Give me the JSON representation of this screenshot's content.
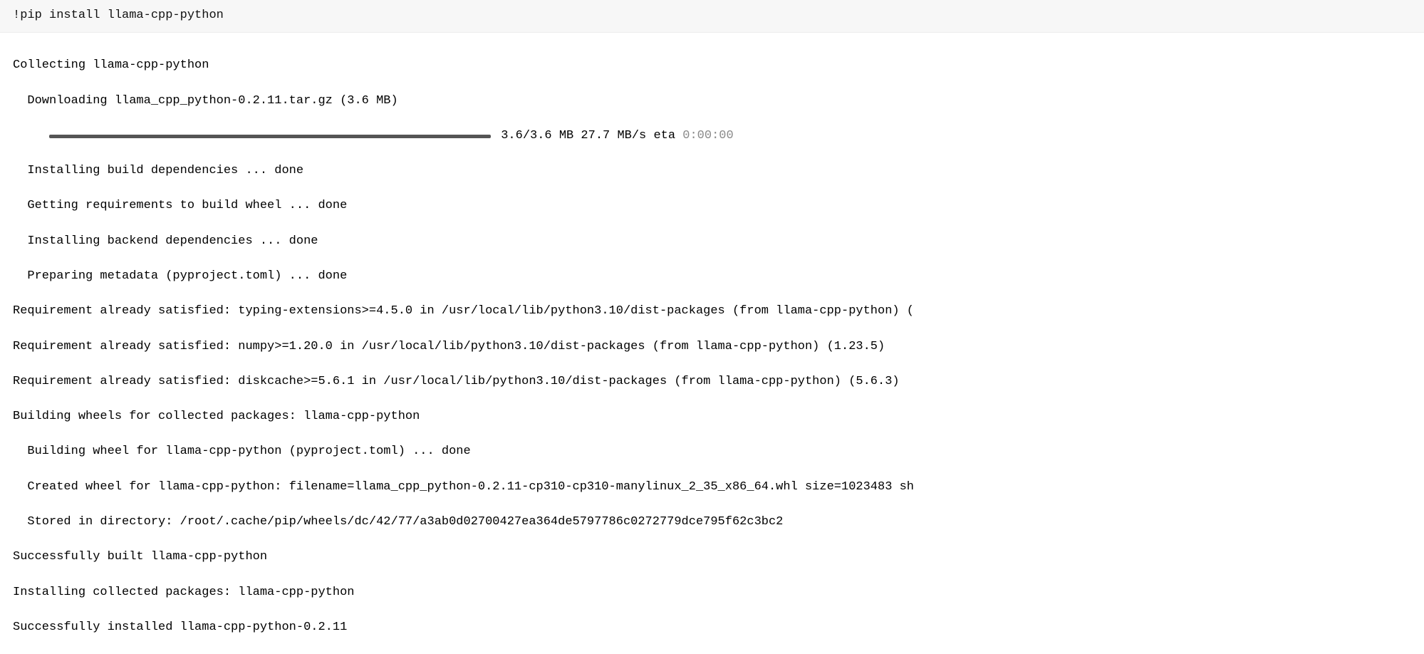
{
  "code_cell": {
    "command": "!pip install llama-cpp-python"
  },
  "output": {
    "line1": "Collecting llama-cpp-python",
    "line2": "  Downloading llama_cpp_python-0.2.11.tar.gz (3.6 MB)",
    "progress_indent": "     ",
    "progress_stats": " 3.6/3.6 MB 27.7 MB/s eta ",
    "progress_eta": "0:00:00",
    "line4": "  Installing build dependencies ... done",
    "line5": "  Getting requirements to build wheel ... done",
    "line6": "  Installing backend dependencies ... done",
    "line7": "  Preparing metadata (pyproject.toml) ... done",
    "line8": "Requirement already satisfied: typing-extensions>=4.5.0 in /usr/local/lib/python3.10/dist-packages (from llama-cpp-python) (",
    "line9": "Requirement already satisfied: numpy>=1.20.0 in /usr/local/lib/python3.10/dist-packages (from llama-cpp-python) (1.23.5)",
    "line10": "Requirement already satisfied: diskcache>=5.6.1 in /usr/local/lib/python3.10/dist-packages (from llama-cpp-python) (5.6.3)",
    "line11": "Building wheels for collected packages: llama-cpp-python",
    "line12": "  Building wheel for llama-cpp-python (pyproject.toml) ... done",
    "line13": "  Created wheel for llama-cpp-python: filename=llama_cpp_python-0.2.11-cp310-cp310-manylinux_2_35_x86_64.whl size=1023483 sh",
    "line14": "  Stored in directory: /root/.cache/pip/wheels/dc/42/77/a3ab0d02700427ea364de5797786c0272779dce795f62c3bc2",
    "line15": "Successfully built llama-cpp-python",
    "line16": "Installing collected packages: llama-cpp-python",
    "line17": "Successfully installed llama-cpp-python-0.2.11"
  }
}
